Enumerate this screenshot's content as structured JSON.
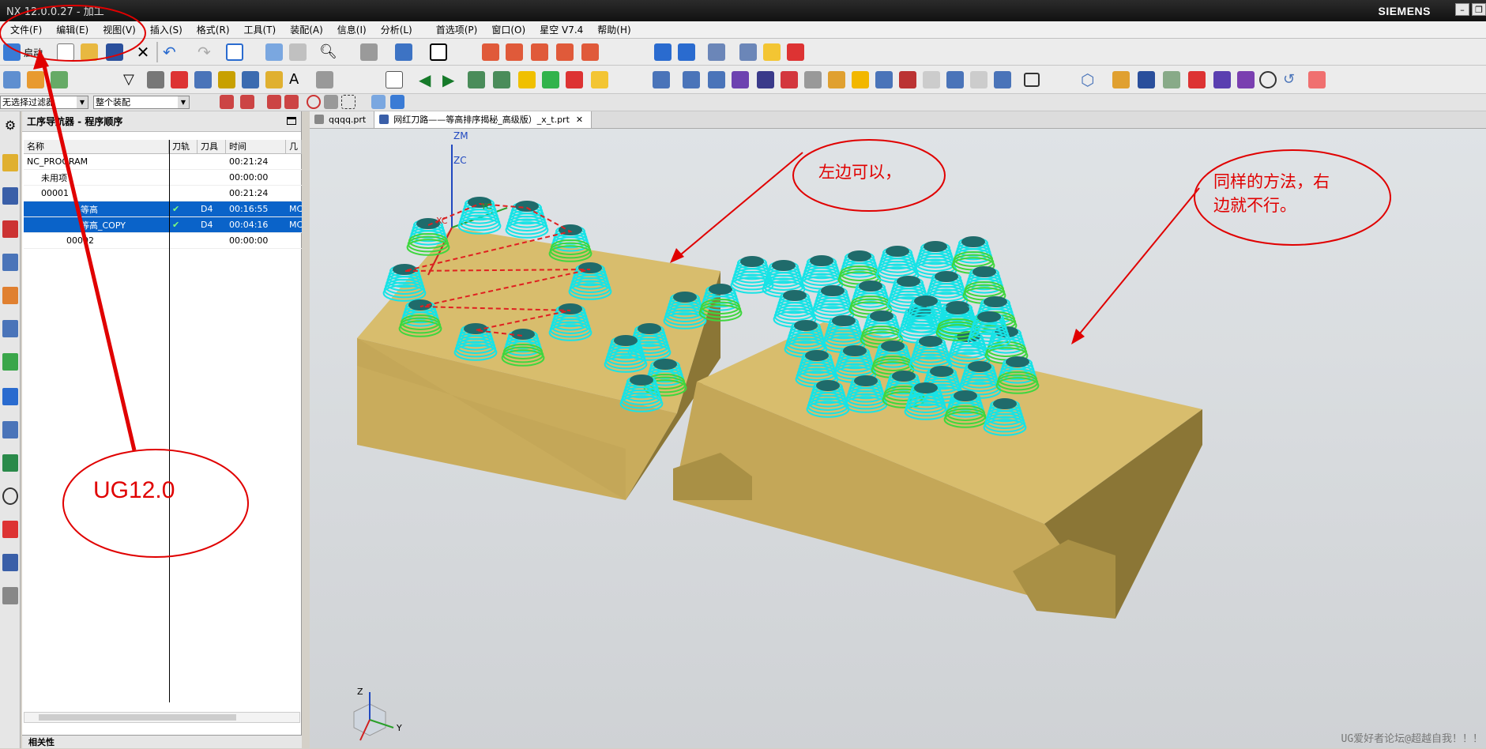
{
  "window": {
    "title": "NX 12.0.0.27 - 加工",
    "brand": "SIEMENS",
    "controls": [
      "–",
      "❐"
    ]
  },
  "menu": [
    "文件(F)",
    "编辑(E)",
    "视图(V)",
    "插入(S)",
    "格式(R)",
    "工具(T)",
    "装配(A)",
    "信息(I)",
    "分析(L)",
    "首选项(P)",
    "窗口(O)",
    "星空 V7.4",
    "帮助(H)"
  ],
  "toolbar": {
    "start_label": "启动",
    "filter_select": "无选择过滤器",
    "assembly_select": "整个装配"
  },
  "navigator": {
    "title": "工序导航器 - 程序顺序",
    "columns": [
      "名称",
      "刀轨",
      "刀具",
      "时间",
      "几"
    ],
    "rows": [
      {
        "name": "NC_PROGRAM",
        "path": "",
        "tool": "",
        "time": "00:21:24",
        "extra": "",
        "selected": false
      },
      {
        "name": "未用项",
        "path": "",
        "tool": "",
        "time": "00:00:00",
        "extra": "",
        "selected": false
      },
      {
        "name": "00001",
        "path": "",
        "tool": "",
        "time": "00:21:24",
        "extra": "",
        "selected": false
      },
      {
        "name": "等高",
        "path": "✔",
        "tool": "D4",
        "time": "00:16:55",
        "extra": "MC",
        "selected": true
      },
      {
        "name": "等高_COPY",
        "path": "✔",
        "tool": "D4",
        "time": "00:04:16",
        "extra": "MC",
        "selected": true
      },
      {
        "name": "00002",
        "path": "",
        "tool": "",
        "time": "00:00:00",
        "extra": "",
        "selected": false
      }
    ],
    "related_panel": "相关性"
  },
  "tabs": [
    {
      "label": "qqqq.prt",
      "active": false
    },
    {
      "label": "网红刀路——等高排序揭秘_高级版）_x_t.prt",
      "active": true
    }
  ],
  "viewport": {
    "axis_labels": {
      "zm": "ZM",
      "zc": "ZC",
      "yc": "YC",
      "xc": "XC",
      "triad_z": "Z",
      "triad_y": "Y"
    },
    "annotations": {
      "left_ok": "左边可以，",
      "right_fail_line1": "同样的方法，右",
      "right_fail_line2": "边就不行。",
      "version": "UG12.0"
    },
    "watermark": "UG爱好者论坛@超越自我！！！"
  },
  "colors": {
    "annotation_red": "#e00000",
    "selection_blue": "#0a63c9",
    "part_gold": "#d7bd6e",
    "toolpath_cyan": "#17e3e6",
    "toolpath_green": "#3fd63f"
  }
}
